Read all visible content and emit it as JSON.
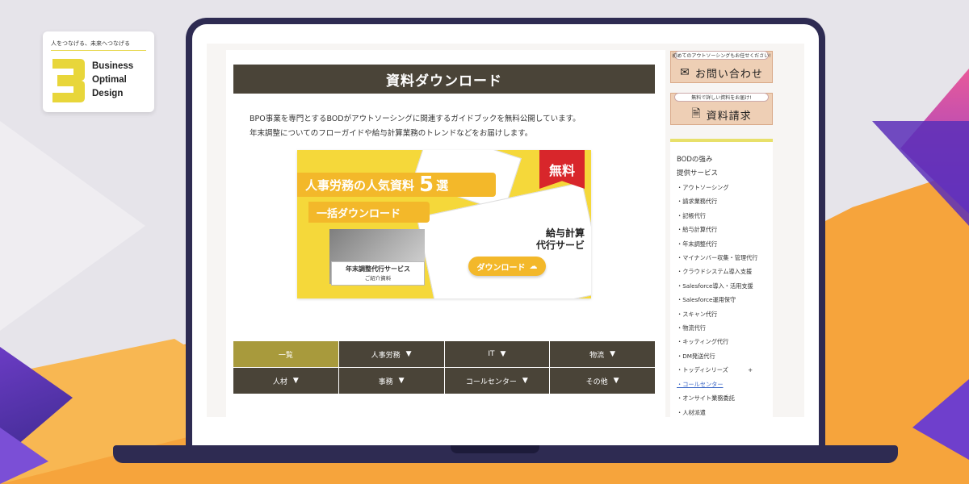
{
  "logo": {
    "tagline": "人をつなげる、未来へつなげる",
    "words": [
      "Business",
      "Optimal",
      "Design"
    ]
  },
  "page": {
    "title": "資料ダウンロード",
    "intro": [
      "BPO事業を専門とするBODがアウトソーシングに関連するガイドブックを無料公開しています。",
      "年末調整についてのフローガイドや給与計算業務のトレンドなどをお届けします。"
    ],
    "banner": {
      "headline": "人事労務の人気資料",
      "number": "5",
      "number_suffix": "選",
      "sub": "一括ダウンロード",
      "free": "無料",
      "download": "ダウンロード",
      "caption_top": "年末調整代行サービス",
      "caption_bottom": "ご紹介資料",
      "service_1": "給与計算",
      "service_2": "代行サービ"
    },
    "categories": [
      {
        "label": "一覧",
        "arrow": ""
      },
      {
        "label": "人事労務",
        "arrow": "▼"
      },
      {
        "label": "IT",
        "arrow": "▼"
      },
      {
        "label": "物流",
        "arrow": "▼"
      },
      {
        "label": "人材",
        "arrow": "▼"
      },
      {
        "label": "事務",
        "arrow": "▼"
      },
      {
        "label": "コールセンター",
        "arrow": "▼"
      },
      {
        "label": "その他",
        "arrow": "▼"
      }
    ]
  },
  "sidebar": {
    "contact": {
      "tag": "初めてのアウトソーシングもお任せください!",
      "label": "お問い合わせ",
      "icon": "mail-icon"
    },
    "request": {
      "tag": "無料で詳しい資料をお届け!",
      "label": "資料請求",
      "icon": "document-icon"
    },
    "strengths": "BODの強み",
    "services_heading": "提供サービス",
    "services": [
      "・アウトソーシング",
      "・請求業務代行",
      "・記帳代行",
      "・給与計算代行",
      "・年末調整代行",
      "・マイナンバー収集・管理代行",
      "・クラウドシステム導入支援",
      "・Salesforce導入・活用支援",
      "・Salesforce運用保守",
      "・スキャン代行",
      "・物流代行",
      "・キッティング代行",
      "・DM発送代行",
      "・トッディシリーズ",
      "・コールセンター",
      "・オンサイト業務委託",
      "・人材派遣"
    ],
    "expand_symbol": "+",
    "link_item": "・コールセンター"
  },
  "colors": {
    "title_bar": "#4a4438",
    "active_category": "#a89a3c",
    "laptop": "#2e2b52",
    "accent_yellow": "#f5d83a",
    "background_orange": "#f6a43c"
  }
}
